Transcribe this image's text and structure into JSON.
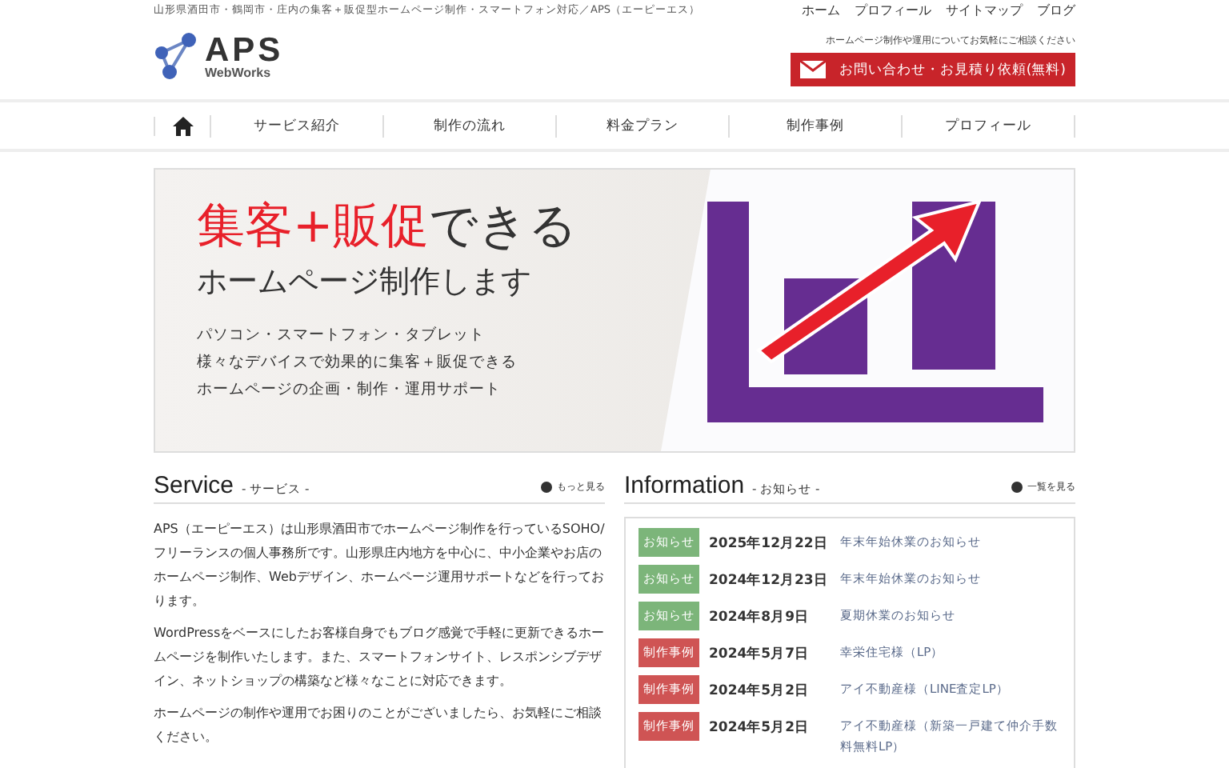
{
  "header": {
    "tagline": "山形県酒田市・鶴岡市・庄内の集客＋販促型ホームページ制作・スマートフォン対応／APS（エーピーエス）",
    "logo": {
      "name": "APS",
      "sub": "WebWorks"
    },
    "top_links": [
      "ホーム",
      "プロフィール",
      "サイトマップ",
      "ブログ"
    ],
    "contact_note": "ホームページ制作や運用についてお気軽にご相談ください",
    "contact_button": "お問い合わせ・お見積り依頼(無料)"
  },
  "nav": {
    "items": [
      "サービス紹介",
      "制作の流れ",
      "料金プラン",
      "制作事例",
      "プロフィール"
    ]
  },
  "hero": {
    "headline_accent": "集客+販促",
    "headline_rest": "できる",
    "subheadline": "ホームページ制作します",
    "lines": [
      "パソコン・スマートフォン・タブレット",
      "様々なデバイスで効果的に集客＋販促できる",
      "ホームページの企画・制作・運用サポート"
    ]
  },
  "service": {
    "title": "Service",
    "subtitle": "- サービス -",
    "more": "もっと見る",
    "paragraphs": [
      "APS（エーピーエス）は山形県酒田市でホームページ制作を行っているSOHO/フリーランスの個人事務所です。山形県庄内地方を中心に、中小企業やお店のホームページ制作、Webデザイン、ホームページ運用サポートなどを行っております。",
      "WordPressをベースにしたお客様自身でもブログ感覚で手軽に更新できるホームページを制作いたします。また、スマートフォンサイト、レスポンシブデザイン、ネットショップの構築など様々なことに対応できます。",
      "ホームページの制作や運用でお困りのことがございましたら、お気軽にご相談ください。"
    ]
  },
  "information": {
    "title": "Information",
    "subtitle": "- お知らせ -",
    "more": "一覧を見る",
    "items": [
      {
        "kind": "notice",
        "tag": "お知らせ",
        "date": "2025年12月22日",
        "title": "年末年始休業のお知らせ"
      },
      {
        "kind": "notice",
        "tag": "お知らせ",
        "date": "2024年12月23日",
        "title": "年末年始休業のお知らせ"
      },
      {
        "kind": "notice",
        "tag": "お知らせ",
        "date": "2024年8月9日",
        "title": "夏期休業のお知らせ"
      },
      {
        "kind": "works",
        "tag": "制作事例",
        "date": "2024年5月7日",
        "title": "幸栄住宅様（LP）"
      },
      {
        "kind": "works",
        "tag": "制作事例",
        "date": "2024年5月2日",
        "title": "アイ不動産様（LINE査定LP）"
      },
      {
        "kind": "works",
        "tag": "制作事例",
        "date": "2024年5月2日",
        "title": "アイ不動産様（新築一戸建て仲介手数料無料LP）"
      }
    ]
  }
}
